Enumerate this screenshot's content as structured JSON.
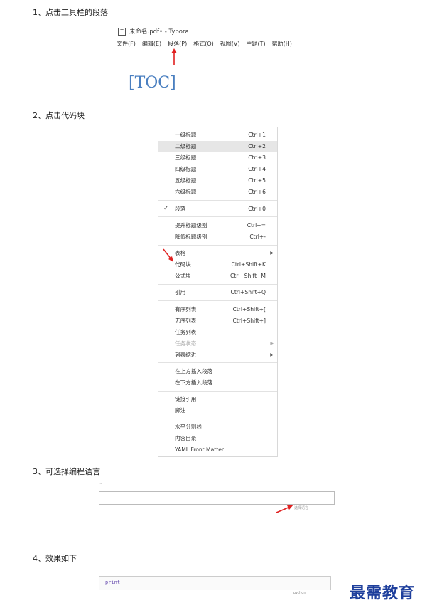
{
  "steps": {
    "s1": "1、点击工具栏的段落",
    "s2": "2、点击代码块",
    "s3": "3、可选择编程语言",
    "s4": "4、效果如下"
  },
  "typora": {
    "icon_letter": "T",
    "title": "未命名.pdf• - Typora",
    "menus": [
      "文件(F)",
      "编辑(E)",
      "段落(P)",
      "格式(O)",
      "视图(V)",
      "主题(T)",
      "帮助(H)"
    ]
  },
  "toc_text": "[TOC]",
  "paragraph_menu": {
    "h1": {
      "label": "一级标题",
      "shortcut": "Ctrl+1"
    },
    "h2": {
      "label": "二级标题",
      "shortcut": "Ctrl+2"
    },
    "h3": {
      "label": "三级标题",
      "shortcut": "Ctrl+3"
    },
    "h4": {
      "label": "四级标题",
      "shortcut": "Ctrl+4"
    },
    "h5": {
      "label": "五级标题",
      "shortcut": "Ctrl+5"
    },
    "h6": {
      "label": "六级标题",
      "shortcut": "Ctrl+6"
    },
    "para": {
      "label": "段落",
      "shortcut": "Ctrl+0",
      "check": "✓"
    },
    "promote": {
      "label": "提升标题级别",
      "shortcut": "Ctrl+="
    },
    "demote": {
      "label": "降低标题级别",
      "shortcut": "Ctrl+-"
    },
    "table": {
      "label": "表格"
    },
    "codeblock": {
      "label": "代码块",
      "shortcut": "Ctrl+Shift+K"
    },
    "mathblock": {
      "label": "公式块",
      "shortcut": "Ctrl+Shift+M"
    },
    "quote": {
      "label": "引用",
      "shortcut": "Ctrl+Shift+Q"
    },
    "ol": {
      "label": "有序列表",
      "shortcut": "Ctrl+Shift+["
    },
    "ul": {
      "label": "无序列表",
      "shortcut": "Ctrl+Shift+]"
    },
    "task": {
      "label": "任务列表"
    },
    "taskstatus": {
      "label": "任务状态"
    },
    "indent": {
      "label": "列表缩进"
    },
    "insert_above": {
      "label": "在上方插入段落"
    },
    "insert_below": {
      "label": "在下方插入段落"
    },
    "linkref": {
      "label": "链接引用"
    },
    "footnote": {
      "label": "脚注"
    },
    "hr": {
      "label": "水平分割线"
    },
    "toc": {
      "label": "内容目录"
    },
    "yaml": {
      "label": "YAML Front Matter"
    },
    "submenu_glyph": "▶"
  },
  "code_step": {
    "top_mark": "~",
    "lang_placeholder": "选择语言"
  },
  "result": {
    "code": "print",
    "lang": "python"
  },
  "logo_text": "最需教育",
  "colors": {
    "accent_arrow": "#e02020",
    "toc_blue": "#4a7fc0",
    "logo_blue": "#1e3f9c"
  }
}
